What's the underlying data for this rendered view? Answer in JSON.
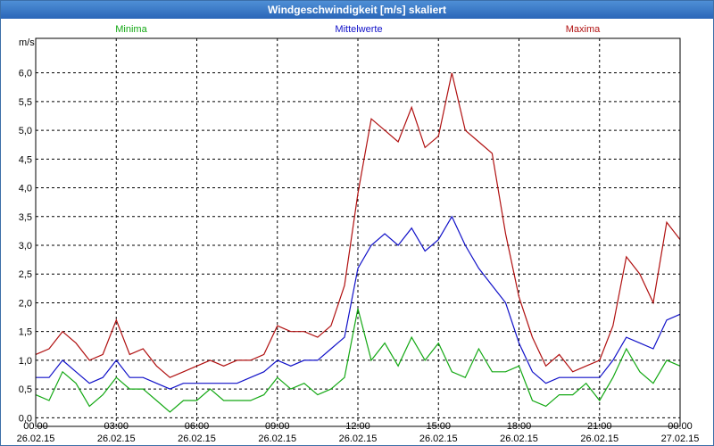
{
  "window": {
    "title": "Windgeschwindigkeit [m/s] skaliert"
  },
  "legend": [
    {
      "label": "Minima",
      "color": "#13a813"
    },
    {
      "label": "Mittelwerte",
      "color": "#1010c8"
    },
    {
      "label": "Maxima",
      "color": "#b01010"
    }
  ],
  "chart_data": {
    "type": "line",
    "title": "Windgeschwindigkeit [m/s] skaliert",
    "ylabel": "m/s",
    "ylim": [
      -0.15,
      6.6
    ],
    "xlim": [
      0,
      24
    ],
    "y_ticks": [
      "0,0",
      "0,5",
      "1,0",
      "1,5",
      "2,0",
      "2,5",
      "3,0",
      "3,5",
      "4,0",
      "4,5",
      "5,0",
      "5,5",
      "6,0"
    ],
    "x_ticks": [
      {
        "time": "00:00",
        "date": "26.02.15"
      },
      {
        "time": "03:00",
        "date": "26.02.15"
      },
      {
        "time": "06:00",
        "date": "26.02.15"
      },
      {
        "time": "09:00",
        "date": "26.02.15"
      },
      {
        "time": "12:00",
        "date": "26.02.15"
      },
      {
        "time": "15:00",
        "date": "26.02.15"
      },
      {
        "time": "18:00",
        "date": "26.02.15"
      },
      {
        "time": "21:00",
        "date": "26.02.15"
      },
      {
        "time": "00:00",
        "date": "27.02.15"
      }
    ],
    "x_hours": [
      0,
      0.5,
      1,
      1.5,
      2,
      2.5,
      3,
      3.5,
      4,
      4.5,
      5,
      5.5,
      6,
      6.5,
      7,
      7.5,
      8,
      8.5,
      9,
      9.5,
      10,
      10.5,
      11,
      11.5,
      12,
      12.5,
      13,
      13.5,
      14,
      14.5,
      15,
      15.5,
      16,
      16.5,
      17,
      17.5,
      18,
      18.5,
      19,
      19.5,
      20,
      20.5,
      21,
      21.5,
      22,
      22.5,
      23,
      23.5,
      24
    ],
    "grid": true,
    "series": [
      {
        "name": "Minima",
        "color": "#13a813",
        "values": [
          0.4,
          0.3,
          0.8,
          0.6,
          0.2,
          0.4,
          0.7,
          0.5,
          0.5,
          0.3,
          0.1,
          0.3,
          0.3,
          0.5,
          0.3,
          0.3,
          0.3,
          0.4,
          0.7,
          0.5,
          0.6,
          0.4,
          0.5,
          0.7,
          1.9,
          1.0,
          1.3,
          0.9,
          1.4,
          1.0,
          1.3,
          0.8,
          0.7,
          1.2,
          0.8,
          0.8,
          0.9,
          0.3,
          0.2,
          0.4,
          0.4,
          0.6,
          0.3,
          0.7,
          1.2,
          0.8,
          0.6,
          1.0,
          0.9
        ]
      },
      {
        "name": "Mittelwerte",
        "color": "#1010c8",
        "values": [
          0.7,
          0.7,
          1.0,
          0.8,
          0.6,
          0.7,
          1.0,
          0.7,
          0.7,
          0.6,
          0.5,
          0.6,
          0.6,
          0.6,
          0.6,
          0.6,
          0.7,
          0.8,
          1.0,
          0.9,
          1.0,
          1.0,
          1.2,
          1.4,
          2.6,
          3.0,
          3.2,
          3.0,
          3.3,
          2.9,
          3.1,
          3.5,
          3.0,
          2.6,
          2.3,
          2.0,
          1.3,
          0.8,
          0.6,
          0.7,
          0.7,
          0.7,
          0.7,
          1.0,
          1.4,
          1.3,
          1.2,
          1.7,
          1.8
        ]
      },
      {
        "name": "Maxima",
        "color": "#b01010",
        "values": [
          1.1,
          1.2,
          1.5,
          1.3,
          1.0,
          1.1,
          1.7,
          1.1,
          1.2,
          0.9,
          0.7,
          0.8,
          0.9,
          1.0,
          0.9,
          1.0,
          1.0,
          1.1,
          1.6,
          1.5,
          1.5,
          1.4,
          1.6,
          2.3,
          3.9,
          5.2,
          5.0,
          4.8,
          5.4,
          4.7,
          4.9,
          6.0,
          5.0,
          4.8,
          4.6,
          3.2,
          2.1,
          1.4,
          0.9,
          1.1,
          0.8,
          0.9,
          1.0,
          1.6,
          2.8,
          2.5,
          2.0,
          3.4,
          3.1
        ]
      }
    ]
  }
}
